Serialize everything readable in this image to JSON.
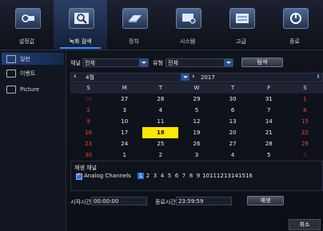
{
  "top_menu": [
    {
      "label": "설정값",
      "icon": "camera-gear-icon"
    },
    {
      "label": "녹화 검색",
      "icon": "search-magnifier-icon"
    },
    {
      "label": "장치",
      "icon": "hard-drive-icon"
    },
    {
      "label": "시스템",
      "icon": "system-settings-icon"
    },
    {
      "label": "고급",
      "icon": "advanced-options-icon"
    },
    {
      "label": "종료",
      "icon": "power-icon"
    }
  ],
  "sidebar": [
    {
      "label": "일반",
      "icon": "search-gear-icon"
    },
    {
      "label": "이벤트",
      "icon": "event-icon"
    },
    {
      "label": "Picture",
      "icon": "picture-icon"
    }
  ],
  "filters": {
    "channel_label": "채널",
    "channel_value": "전체",
    "type_label": "유형",
    "type_value": "전체",
    "search_button": "탐색"
  },
  "calendar": {
    "month": "4월",
    "year": "2017",
    "weekdays": [
      "S",
      "M",
      "T",
      "W",
      "T",
      "F",
      "S"
    ],
    "weeks": [
      [
        "26",
        "27",
        "28",
        "29",
        "30",
        "31",
        "1"
      ],
      [
        "2",
        "3",
        "4",
        "5",
        "6",
        "7",
        "8"
      ],
      [
        "9",
        "10",
        "11",
        "12",
        "13",
        "14",
        "15"
      ],
      [
        "16",
        "17",
        "18",
        "19",
        "20",
        "21",
        "22"
      ],
      [
        "23",
        "24",
        "25",
        "26",
        "27",
        "28",
        "29"
      ],
      [
        "30",
        "1",
        "2",
        "3",
        "4",
        "5",
        "6"
      ]
    ],
    "selected_day": "18"
  },
  "playback": {
    "title": "재생 채널",
    "channel_group": "Analog Channels",
    "channels": [
      "1",
      "2",
      "3",
      "4",
      "5",
      "6",
      "7",
      "8",
      "9",
      "10",
      "11",
      "12",
      "13",
      "14",
      "15",
      "16"
    ]
  },
  "time": {
    "start_label": "시작시간",
    "start_value": "00:00:00",
    "end_label": "종료시간",
    "end_value": "23:59:59",
    "play_button": "재생"
  },
  "cancel_button": "취소",
  "colors": {
    "accent": "#2f8fff",
    "selected_day": "#ffe800",
    "sunday_red": "#ff3b3b"
  }
}
